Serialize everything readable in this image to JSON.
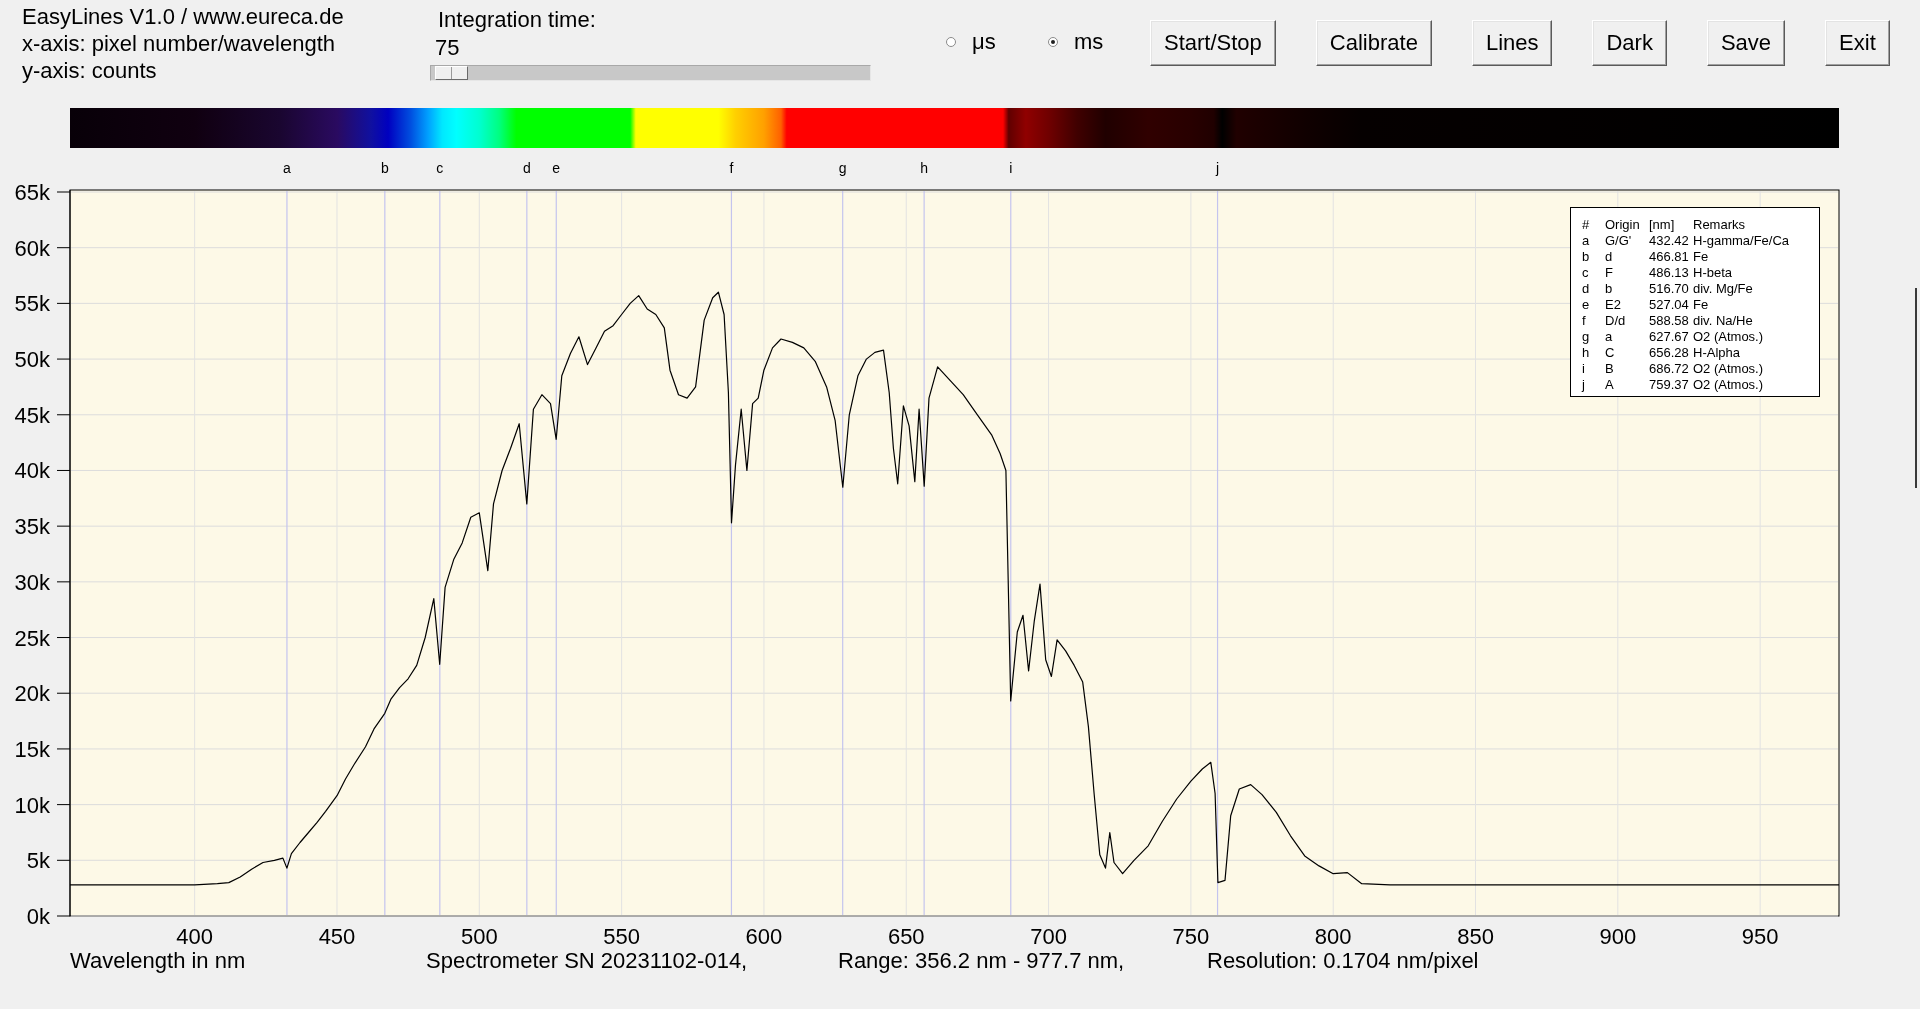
{
  "header": {
    "lines": [
      "EasyLines V1.0 / www.eureca.de",
      "x-axis: pixel number/wavelength",
      "y-axis: counts"
    ]
  },
  "integration": {
    "label": "Integration time:",
    "value": "75",
    "level": 0.01
  },
  "units": [
    {
      "label": "μs",
      "selected": false
    },
    {
      "label": "ms",
      "selected": true
    }
  ],
  "buttons": [
    "Start/Stop",
    "Calibrate",
    "Lines",
    "Dark",
    "Save",
    "Exit"
  ],
  "chart": {
    "chart_data": {
      "type": "line",
      "xlabel": "Wavelength in nm",
      "grid": true,
      "xlim": [
        356.2,
        977.7
      ],
      "ylim": [
        0,
        65000
      ],
      "xticks": [
        400,
        450,
        500,
        550,
        600,
        650,
        700,
        750,
        800,
        850,
        900,
        950
      ],
      "yticks": [
        {
          "value": 0,
          "label": "0k"
        },
        {
          "value": 5000,
          "label": "5k"
        },
        {
          "value": 10000,
          "label": "10k"
        },
        {
          "value": 15000,
          "label": "15k"
        },
        {
          "value": 20000,
          "label": "20k"
        },
        {
          "value": 25000,
          "label": "25k"
        },
        {
          "value": 30000,
          "label": "30k"
        },
        {
          "value": 35000,
          "label": "35k"
        },
        {
          "value": 40000,
          "label": "40k"
        },
        {
          "value": 45000,
          "label": "45k"
        },
        {
          "value": 50000,
          "label": "50k"
        },
        {
          "value": 55000,
          "label": "55k"
        },
        {
          "value": 60000,
          "label": "60k"
        },
        {
          "value": 65000,
          "label": "65k"
        }
      ],
      "x": [
        356.2,
        370,
        385,
        400,
        408,
        412,
        416,
        420,
        424,
        428,
        431,
        432.4,
        434,
        437,
        440,
        443,
        446,
        450,
        453,
        456,
        460,
        463,
        466.8,
        469,
        472,
        475,
        478,
        481,
        484,
        486.1,
        488,
        491,
        494,
        497,
        500,
        503,
        505,
        508,
        511,
        514,
        516.7,
        519,
        522,
        525,
        527,
        529,
        532,
        535,
        538,
        541,
        544,
        547,
        550,
        553,
        556,
        559,
        562,
        565,
        567,
        570,
        573,
        576,
        579,
        582,
        584,
        586,
        587.5,
        588.6,
        590,
        592,
        594,
        596,
        598,
        600,
        603,
        606,
        610,
        614,
        618,
        622,
        625,
        627.7,
        630,
        633,
        636,
        639,
        642,
        644,
        645.5,
        647,
        649,
        651,
        653,
        654.5,
        656.3,
        658,
        661,
        665,
        670,
        675,
        680,
        683,
        685,
        686.7,
        689,
        691,
        693,
        695,
        697,
        699,
        701,
        703,
        706,
        709,
        712,
        714,
        716,
        718,
        720,
        721.5,
        723,
        726,
        730,
        735,
        740,
        745,
        750,
        754,
        757,
        758.5,
        759.5,
        762,
        764,
        767,
        771,
        775,
        780,
        785,
        790,
        795,
        800,
        805,
        810,
        820,
        850,
        880,
        910,
        940,
        977.7
      ],
      "values": [
        2800,
        2800,
        2800,
        2800,
        2900,
        3000,
        3500,
        4200,
        4800,
        5000,
        5200,
        4300,
        5600,
        6600,
        7500,
        8400,
        9400,
        10800,
        12300,
        13600,
        15200,
        16800,
        18200,
        19500,
        20500,
        21300,
        22500,
        25000,
        28500,
        22600,
        29500,
        32000,
        33500,
        35800,
        36200,
        31000,
        37000,
        40000,
        42000,
        44200,
        37000,
        45500,
        46800,
        46000,
        42800,
        48500,
        50500,
        52000,
        49500,
        51000,
        52500,
        53000,
        54000,
        55000,
        55700,
        54500,
        54000,
        52800,
        49000,
        46800,
        46500,
        47500,
        53500,
        55500,
        56000,
        54000,
        47000,
        35300,
        40500,
        45500,
        40000,
        46000,
        46500,
        49000,
        51000,
        51800,
        51500,
        51000,
        49800,
        47500,
        44500,
        38500,
        45000,
        48500,
        50000,
        50600,
        50800,
        47000,
        42000,
        38800,
        45800,
        44000,
        39000,
        45500,
        38600,
        46500,
        49300,
        48200,
        46800,
        45000,
        43200,
        41500,
        40000,
        19300,
        25500,
        27000,
        22000,
        26500,
        29800,
        23000,
        21500,
        24800,
        23800,
        22500,
        21000,
        17000,
        11000,
        5500,
        4300,
        7500,
        4800,
        3800,
        5000,
        6300,
        8500,
        10500,
        12100,
        13200,
        13800,
        11000,
        3000,
        3200,
        9000,
        11400,
        11800,
        10900,
        9300,
        7200,
        5400,
        4500,
        3800,
        3900,
        2900,
        2800,
        2800,
        2800,
        2800,
        2800,
        2800
      ],
      "ref_lines": [
        {
          "axis": "x",
          "value": 432.42,
          "label": "a"
        },
        {
          "axis": "x",
          "value": 466.81,
          "label": "b"
        },
        {
          "axis": "x",
          "value": 486.13,
          "label": "c"
        },
        {
          "axis": "x",
          "value": 516.7,
          "label": "d"
        },
        {
          "axis": "x",
          "value": 527.04,
          "label": "e"
        },
        {
          "axis": "x",
          "value": 588.58,
          "label": "f"
        },
        {
          "axis": "x",
          "value": 627.67,
          "label": "g"
        },
        {
          "axis": "x",
          "value": 656.28,
          "label": "h"
        },
        {
          "axis": "x",
          "value": 686.72,
          "label": "i"
        },
        {
          "axis": "x",
          "value": 759.37,
          "label": "j"
        }
      ]
    }
  },
  "legend": {
    "columns": [
      "#",
      "Origin",
      "[nm]",
      "Remarks"
    ],
    "rows": [
      [
        "a",
        "G/G'",
        "432.42",
        "H-gamma/Fe/Ca"
      ],
      [
        "b",
        "d",
        "466.81",
        "Fe"
      ],
      [
        "c",
        "F",
        "486.13",
        "H-beta"
      ],
      [
        "d",
        "b",
        "516.70",
        "div. Mg/Fe"
      ],
      [
        "e",
        "E2",
        "527.04",
        "Fe"
      ],
      [
        "f",
        "D/d",
        "588.58",
        "div. Na/He"
      ],
      [
        "g",
        "a",
        "627.67",
        "O2 (Atmos.)"
      ],
      [
        "h",
        "C",
        "656.28",
        "H-Alpha"
      ],
      [
        "i",
        "B",
        "686.72",
        "O2 (Atmos.)"
      ],
      [
        "j",
        "A",
        "759.37",
        "O2 (Atmos.)"
      ]
    ]
  },
  "status_bar": [
    "Spectrometer SN 20231102-014,",
    "Range: 356.2 nm - 977.7 nm,",
    "Resolution: 0.1704 nm/pixel"
  ]
}
